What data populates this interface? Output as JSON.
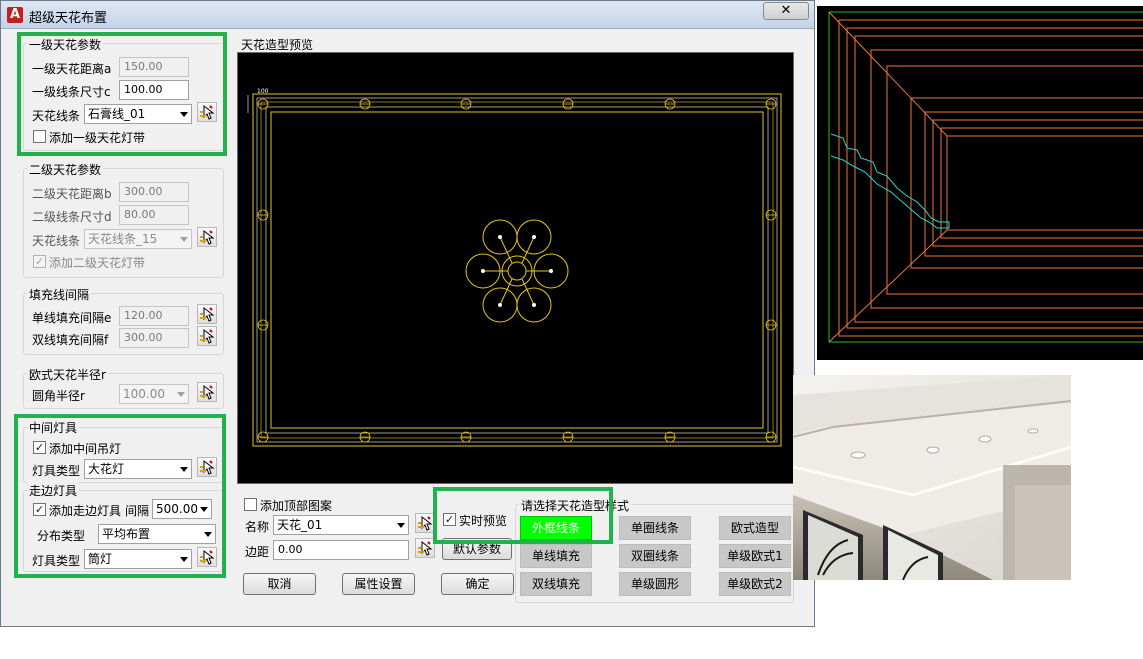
{
  "window": {
    "title": "超级天花布置",
    "app_icon": "A"
  },
  "level1": {
    "title": "一级天花参数",
    "distance_label": "一级天花距离a",
    "distance_value": "150.00",
    "size_label": "一级线条尺寸c",
    "size_value": "100.00",
    "line_label": "天花线条",
    "line_value": "石膏线_01",
    "lightstrip_label": "添加一级天花灯带"
  },
  "level2": {
    "title": "二级天花参数",
    "distance_label": "二级天花距离b",
    "distance_value": "300.00",
    "size_label": "二级线条尺寸d",
    "size_value": "80.00",
    "line_label": "天花线条",
    "line_value": "天花线条_15",
    "lightstrip_label": "添加二级天花灯带"
  },
  "fill": {
    "title": "填充线间隔",
    "single_label": "单线填充间隔e",
    "single_value": "120.00",
    "double_label": "双线填充间隔f",
    "double_value": "300.00"
  },
  "euro": {
    "title": "欧式天花半径r",
    "radius_label": "圆角半径r",
    "radius_value": "100.00"
  },
  "center_light": {
    "title": "中间灯具",
    "add_label": "添加中间吊灯",
    "type_label": "灯具类型",
    "type_value": "大花灯"
  },
  "edge_light": {
    "title": "走边灯具",
    "add_label": "添加走边灯具",
    "spacing_label": "间隔",
    "spacing_value": "500.00",
    "dist_label": "分布类型",
    "dist_value": "平均布置",
    "type_label": "灯具类型",
    "type_value": "筒灯"
  },
  "preview": {
    "title": "天花造型预览",
    "dim_text": "100"
  },
  "top_pattern": {
    "add_label": "添加顶部图案",
    "name_label": "名称",
    "name_value": "天花_01",
    "margin_label": "边距",
    "margin_value": "0.00"
  },
  "realtime_label": "实时预览",
  "default_params_button": "默认参数",
  "buttons": {
    "cancel": "取消",
    "properties": "属性设置",
    "ok": "确定"
  },
  "styles": {
    "title": "请选择天花造型样式",
    "items": [
      "外框线条",
      "单圈线条",
      "欧式造型",
      "单线填充",
      "双圈线条",
      "单级欧式1",
      "双线填充",
      "单级圆形",
      "单级欧式2"
    ],
    "selected_color": "#00ff00"
  },
  "colors": {
    "highlight": "#22b14c",
    "preview_yellow": "#e6c619",
    "preview_white": "#ffffff"
  }
}
